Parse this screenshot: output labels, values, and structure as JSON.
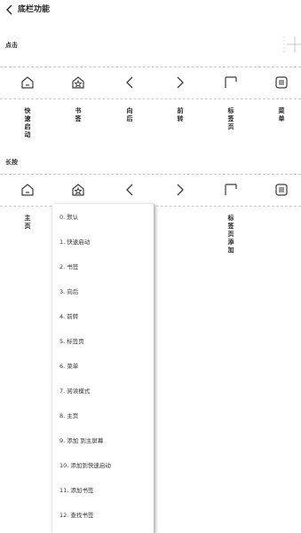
{
  "header": {
    "title": "底栏功能"
  },
  "tap_section": {
    "label": "点击"
  },
  "long_press_section": {
    "label": "长按"
  },
  "tap_labels": [
    "快速启动",
    "书签",
    "向后",
    "前转",
    "标签页",
    "菜单"
  ],
  "long_press_labels": [
    "主页",
    "标签页添加"
  ],
  "dropdown_options": [
    "0. 默认",
    "1. 快速启动",
    "2. 书签",
    "3. 向后",
    "4. 前转",
    "5. 标签页",
    "6. 菜单",
    "7. 阅读模式",
    "8. 主页",
    "9. 添加 到主屏幕",
    "10. 添加到快速启动",
    "11. 添加书签",
    "12. 查找书签"
  ],
  "icons": [
    "home-icon",
    "bookmark-star-icon",
    "chevron-left-icon",
    "chevron-right-icon",
    "tabs-icon",
    "menu-icon"
  ],
  "colors": {
    "icon_stroke": "#3a3a3a",
    "divider": "#c8c8c8"
  }
}
